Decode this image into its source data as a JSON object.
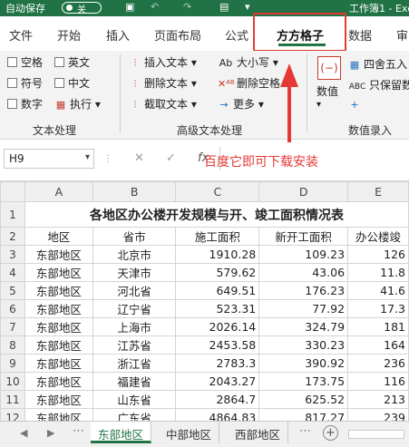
{
  "titlebar": {
    "autosave_label": "自动保存",
    "autosave_state": "关",
    "window_title": "工作簿1 - Exce"
  },
  "tabs": [
    "文件",
    "开始",
    "插入",
    "页面布局",
    "公式",
    "方方格子",
    "数据",
    "审阅"
  ],
  "active_tab": "方方格子",
  "ribbon": {
    "text_group": {
      "checkboxes": [
        "空格",
        "英文",
        "符号",
        "中文",
        "数字"
      ],
      "execute": "执行",
      "label": "文本处理"
    },
    "adv_group": {
      "insert_text": "插入文本",
      "delete_text": "删除文本",
      "extract_text": "截取文本",
      "case": "大小写",
      "delete_space": "删除空格",
      "more": "更多",
      "label": "高级文本处理"
    },
    "num_group": {
      "value": "数值",
      "round": "四舍五入",
      "keep_value": "只保留数",
      "label": "数值录入"
    }
  },
  "formula_bar": {
    "cell_ref": "H9",
    "fx": "fx"
  },
  "annotation": "百度它即可下载安装",
  "sheet": {
    "columns": [
      "A",
      "B",
      "C",
      "D",
      "E"
    ],
    "title": "各地区办公楼开发规模与开、竣工面积情况表",
    "headers": [
      "地区",
      "省市",
      "施工面积",
      "新开工面积",
      "办公楼竣"
    ],
    "rows": [
      {
        "n": "3",
        "cells": [
          "东部地区",
          "北京市",
          "1910.28",
          "109.23",
          "126"
        ]
      },
      {
        "n": "4",
        "cells": [
          "东部地区",
          "天津市",
          "579.62",
          "43.06",
          "11.8"
        ]
      },
      {
        "n": "5",
        "cells": [
          "东部地区",
          "河北省",
          "649.51",
          "176.23",
          "41.6"
        ]
      },
      {
        "n": "6",
        "cells": [
          "东部地区",
          "辽宁省",
          "523.31",
          "77.92",
          "17.3"
        ]
      },
      {
        "n": "7",
        "cells": [
          "东部地区",
          "上海市",
          "2026.14",
          "324.79",
          "181"
        ]
      },
      {
        "n": "8",
        "cells": [
          "东部地区",
          "江苏省",
          "2453.58",
          "330.23",
          "164"
        ]
      },
      {
        "n": "9",
        "cells": [
          "东部地区",
          "浙江省",
          "2783.3",
          "390.92",
          "236"
        ]
      },
      {
        "n": "10",
        "cells": [
          "东部地区",
          "福建省",
          "2043.27",
          "173.75",
          "116"
        ]
      },
      {
        "n": "11",
        "cells": [
          "东部地区",
          "山东省",
          "2864.7",
          "625.52",
          "213"
        ]
      },
      {
        "n": "12",
        "cells": [
          "东部地区",
          "广东省",
          "4864.83",
          "817.27",
          "239"
        ]
      }
    ],
    "row1": "1",
    "row2": "2"
  },
  "sheet_tabs": [
    "东部地区",
    "中部地区",
    "西部地区"
  ],
  "active_sheet": "东部地区",
  "colors": {
    "excel_green": "#217346",
    "annotation_red": "#e53935"
  }
}
